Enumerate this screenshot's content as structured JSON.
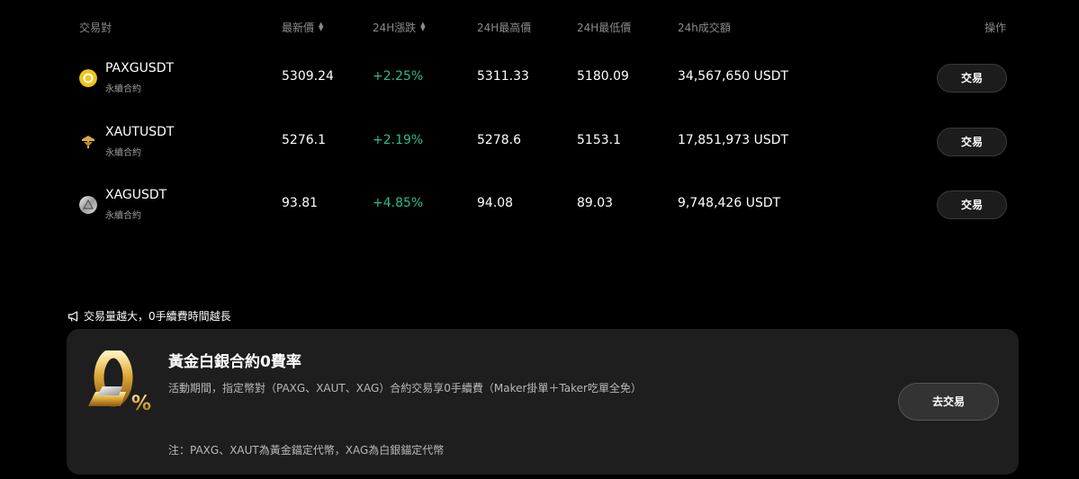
{
  "table": {
    "headers": {
      "pair": "交易對",
      "last_price": "最新價",
      "change_24h": "24H漲跌",
      "high_24h": "24H最高價",
      "low_24h": "24H最低價",
      "volume_24h": "24h成交額",
      "action": "操作"
    },
    "rows": [
      {
        "symbol": "PAXGUSDT",
        "type": "永續合約",
        "last": "5309.24",
        "change": "+2.25%",
        "high": "5311.33",
        "low": "5180.09",
        "volume": "34,567,650 USDT",
        "button": "交易"
      },
      {
        "symbol": "XAUTUSDT",
        "type": "永續合約",
        "last": "5276.1",
        "change": "+2.19%",
        "high": "5278.6",
        "low": "5153.1",
        "volume": "17,851,973 USDT",
        "button": "交易"
      },
      {
        "symbol": "XAGUSDT",
        "type": "永續合約",
        "last": "93.81",
        "change": "+4.85%",
        "high": "94.08",
        "low": "89.03",
        "volume": "9,748,426 USDT",
        "button": "交易"
      }
    ]
  },
  "promo": {
    "headline": "交易量越大，0手續費時間越長",
    "title": "黃金白銀合約0費率",
    "description": "活動期間，指定幣對（PAXG、XAUT、XAG）合約交易享0手續費（Maker掛單＋Taker吃單全免）",
    "note": "注：PAXG、XAUT為黃金錨定代幣，XAG為白銀錨定代幣",
    "button": "去交易"
  },
  "colors": {
    "positive": "#2ebd85",
    "paxg_coin": "#f0c419",
    "gold": "#d9a94a"
  },
  "icons": {
    "sort": "sort-icon",
    "megaphone": "megaphone-icon",
    "promo": "zero-percent-gold-icon"
  }
}
